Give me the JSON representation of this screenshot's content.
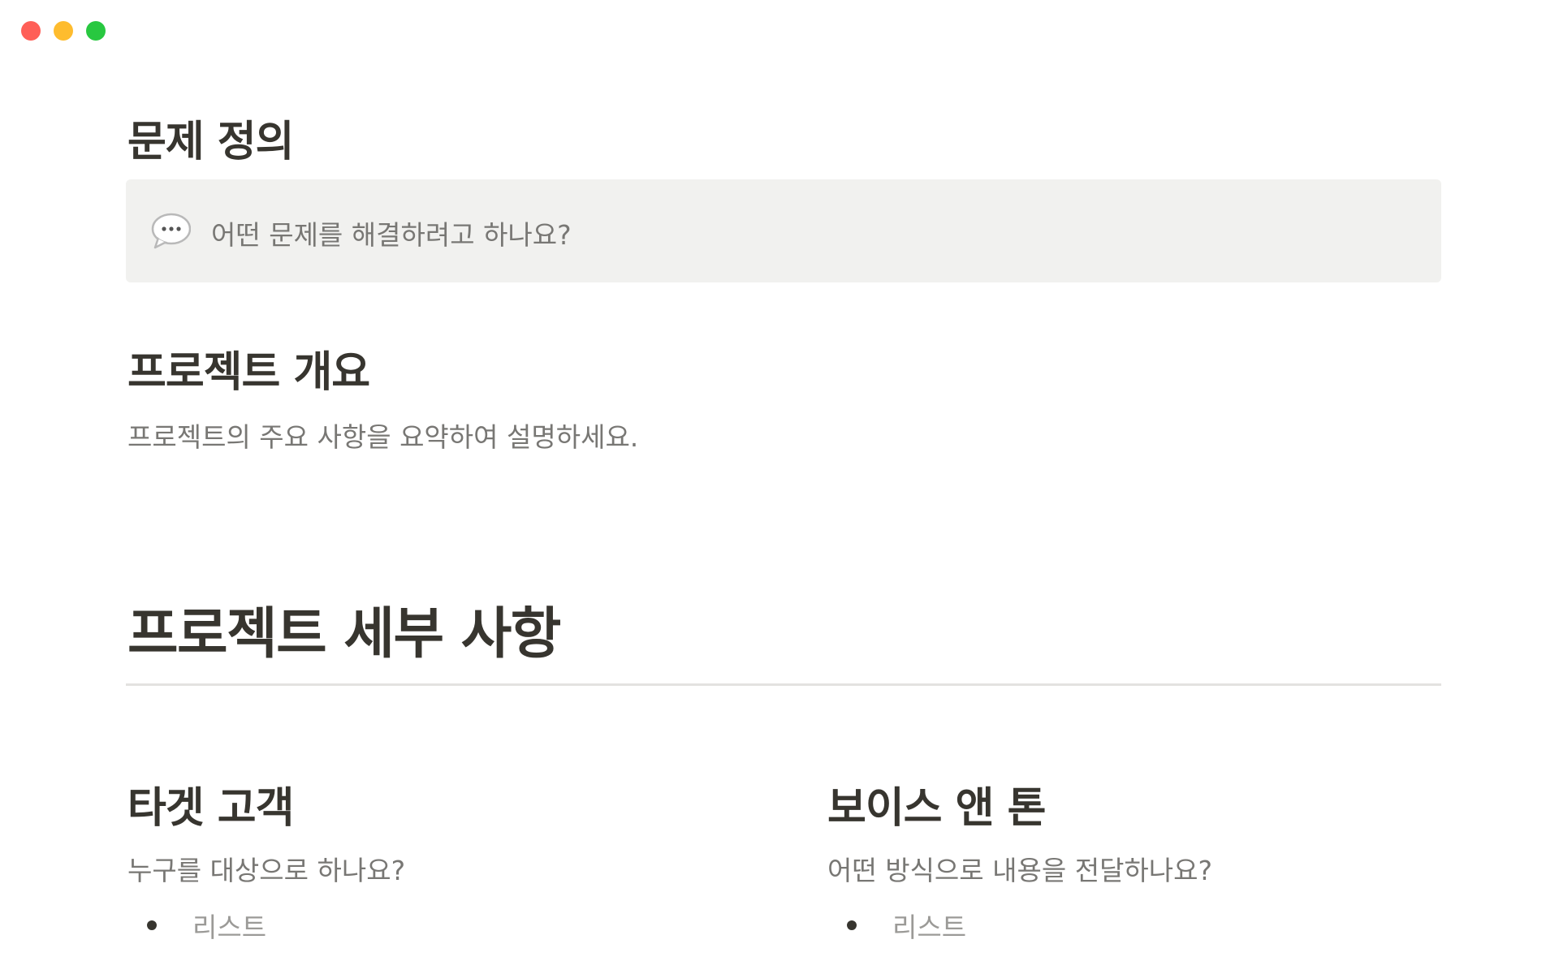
{
  "window": {
    "controls": [
      "close",
      "minimize",
      "zoom"
    ]
  },
  "sections": {
    "problem": {
      "heading": "문제 정의",
      "callout": {
        "icon": "speech-balloon-icon",
        "text": "어떤 문제를 해결하려고 하나요?"
      }
    },
    "overview": {
      "heading": "프로젝트 개요",
      "body": "프로젝트의 주요 사항을 요약하여 설명하세요."
    },
    "details": {
      "heading": "프로젝트 세부 사항"
    },
    "target": {
      "heading": "타겟 고객",
      "body": "누구를 대상으로 하나요?",
      "list_item": "리스트"
    },
    "voice": {
      "heading": "보이스 앤 톤",
      "body": "어떤 방식으로 내용을 전달하나요?",
      "list_item": "리스트"
    }
  },
  "colors": {
    "text": "#37352f",
    "muted_text": "#787774",
    "placeholder_text": "#9b9a97",
    "callout_bg": "#f1f1ef",
    "divider": "#e3e2e0"
  }
}
